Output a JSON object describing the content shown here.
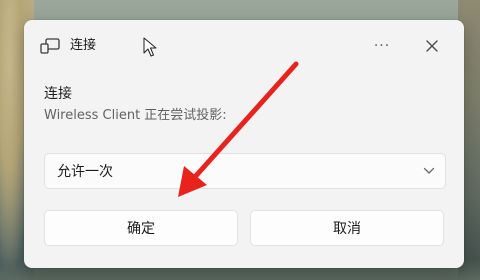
{
  "dialog": {
    "title": "连接",
    "more_label": "···",
    "heading": "连接",
    "message": "Wireless Client 正在尝试投影:",
    "select": {
      "value": "允许一次"
    },
    "buttons": {
      "ok_label": "确定",
      "cancel_label": "取消"
    }
  },
  "icons": {
    "title": "cast-icon",
    "more": "more-icon",
    "close": "close-icon",
    "chevron": "chevron-down-icon",
    "cursor": "mouse-pointer-icon",
    "annotation": "red-arrow-icon"
  },
  "colors": {
    "dialog_bg": "#f3f3f3",
    "annotation_arrow": "#e8231c",
    "text_primary": "#1c1c1c",
    "text_secondary": "#626262"
  }
}
